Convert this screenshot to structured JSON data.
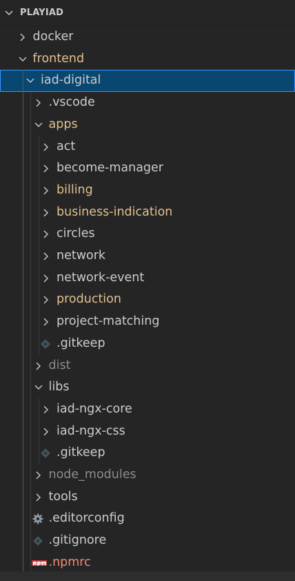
{
  "header": {
    "title": "PLAYIAD"
  },
  "colors": {
    "background": "#252526",
    "selection": "#094771",
    "modified": "#e2c08d",
    "ignored": "#8c8c8c",
    "default": "#cccccc",
    "npm": "#cb3837"
  },
  "tree": [
    {
      "label": "docker",
      "kind": "folder",
      "expanded": false,
      "state": "default",
      "depth": 1
    },
    {
      "label": "frontend",
      "kind": "folder",
      "expanded": true,
      "state": "modified",
      "depth": 1
    },
    {
      "label": "iad-digital",
      "kind": "folder",
      "expanded": true,
      "state": "default",
      "depth": 2,
      "selected": true
    },
    {
      "label": ".vscode",
      "kind": "folder",
      "expanded": false,
      "state": "default",
      "depth": 3
    },
    {
      "label": "apps",
      "kind": "folder",
      "expanded": true,
      "state": "modified",
      "depth": 3
    },
    {
      "label": "act",
      "kind": "folder",
      "expanded": false,
      "state": "default",
      "depth": 4
    },
    {
      "label": "become-manager",
      "kind": "folder",
      "expanded": false,
      "state": "default",
      "depth": 4
    },
    {
      "label": "billing",
      "kind": "folder",
      "expanded": false,
      "state": "modified",
      "depth": 4
    },
    {
      "label": "business-indication",
      "kind": "folder",
      "expanded": false,
      "state": "modified",
      "depth": 4
    },
    {
      "label": "circles",
      "kind": "folder",
      "expanded": false,
      "state": "default",
      "depth": 4
    },
    {
      "label": "network",
      "kind": "folder",
      "expanded": false,
      "state": "default",
      "depth": 4
    },
    {
      "label": "network-event",
      "kind": "folder",
      "expanded": false,
      "state": "default",
      "depth": 4
    },
    {
      "label": "production",
      "kind": "folder",
      "expanded": false,
      "state": "modified",
      "depth": 4
    },
    {
      "label": "project-matching",
      "kind": "folder",
      "expanded": false,
      "state": "default",
      "depth": 4
    },
    {
      "label": ".gitkeep",
      "kind": "file",
      "icon": "git-icon",
      "state": "default",
      "depth": 4
    },
    {
      "label": "dist",
      "kind": "folder",
      "expanded": false,
      "state": "ignored",
      "depth": 3
    },
    {
      "label": "libs",
      "kind": "folder",
      "expanded": true,
      "state": "default",
      "depth": 3
    },
    {
      "label": "iad-ngx-core",
      "kind": "folder",
      "expanded": false,
      "state": "default",
      "depth": 4
    },
    {
      "label": "iad-ngx-css",
      "kind": "folder",
      "expanded": false,
      "state": "default",
      "depth": 4
    },
    {
      "label": ".gitkeep",
      "kind": "file",
      "icon": "git-icon",
      "state": "default",
      "depth": 4
    },
    {
      "label": "node_modules",
      "kind": "folder",
      "expanded": false,
      "state": "ignored",
      "depth": 3
    },
    {
      "label": "tools",
      "kind": "folder",
      "expanded": false,
      "state": "default",
      "depth": 3
    },
    {
      "label": ".editorconfig",
      "kind": "file",
      "icon": "gear-icon",
      "state": "default",
      "depth": 3
    },
    {
      "label": ".gitignore",
      "kind": "file",
      "icon": "git-icon",
      "state": "default",
      "depth": 3
    },
    {
      "label": ".npmrc",
      "kind": "file",
      "icon": "npm-icon",
      "state": "npm",
      "depth": 3
    }
  ]
}
